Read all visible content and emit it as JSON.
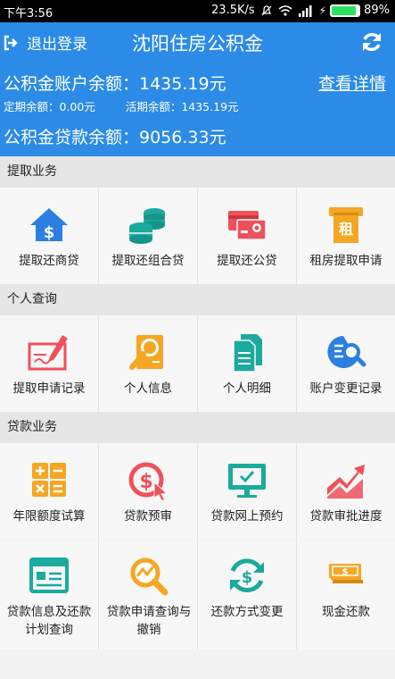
{
  "status_bar": {
    "time": "下午3:56",
    "network_speed": "23.5K/s",
    "battery": "89%",
    "battery_level": 0.89
  },
  "header": {
    "logout_label": "退出登录",
    "title": "沈阳住房公积金",
    "account_balance": "公积金账户余额：1435.19元",
    "details_link": "查看详情",
    "fixed_balance": "定期余额：0.00元",
    "current_balance": "活期余额：1435.19元",
    "loan_balance": "公积金贷款余额：9056.33元"
  },
  "sections": [
    {
      "title": "提取业务",
      "items": [
        {
          "label": "提取还商贷",
          "icon": "house-dollar-icon"
        },
        {
          "label": "提取还组合贷",
          "icon": "coin-stack-icon"
        },
        {
          "label": "提取还公贷",
          "icon": "bank-card-icon"
        },
        {
          "label": "租房提取申请",
          "icon": "rent-atm-icon"
        }
      ]
    },
    {
      "title": "个人查询",
      "items": [
        {
          "label": "提取申请记录",
          "icon": "check-sign-icon"
        },
        {
          "label": "个人信息",
          "icon": "person-search-icon"
        },
        {
          "label": "个人明细",
          "icon": "document-icon"
        },
        {
          "label": "账户变更记录",
          "icon": "eq-search-icon"
        }
      ]
    },
    {
      "title": "贷款业务",
      "items": [
        {
          "label": "年限额度试算",
          "icon": "calculator-icon"
        },
        {
          "label": "贷款预审",
          "icon": "dollar-cursor-icon"
        },
        {
          "label": "贷款网上预约",
          "icon": "monitor-check-icon"
        },
        {
          "label": "贷款审批进度",
          "icon": "trend-chart-icon"
        },
        {
          "label": "贷款信息及还款计划查询",
          "icon": "info-list-icon"
        },
        {
          "label": "贷款申请查询与撤销",
          "icon": "chart-magnifier-icon"
        },
        {
          "label": "还款方式变更",
          "icon": "dollar-refresh-icon"
        },
        {
          "label": "现金还款",
          "icon": "cash-stack-icon"
        }
      ]
    }
  ],
  "icon_labels": {
    "rent_char": "租"
  },
  "colors": {
    "header_blue": "#2b8be6",
    "teal": "#1aaa9e",
    "red": "#f0505a",
    "orange": "#f5a623",
    "blue": "#2b7fe0"
  }
}
